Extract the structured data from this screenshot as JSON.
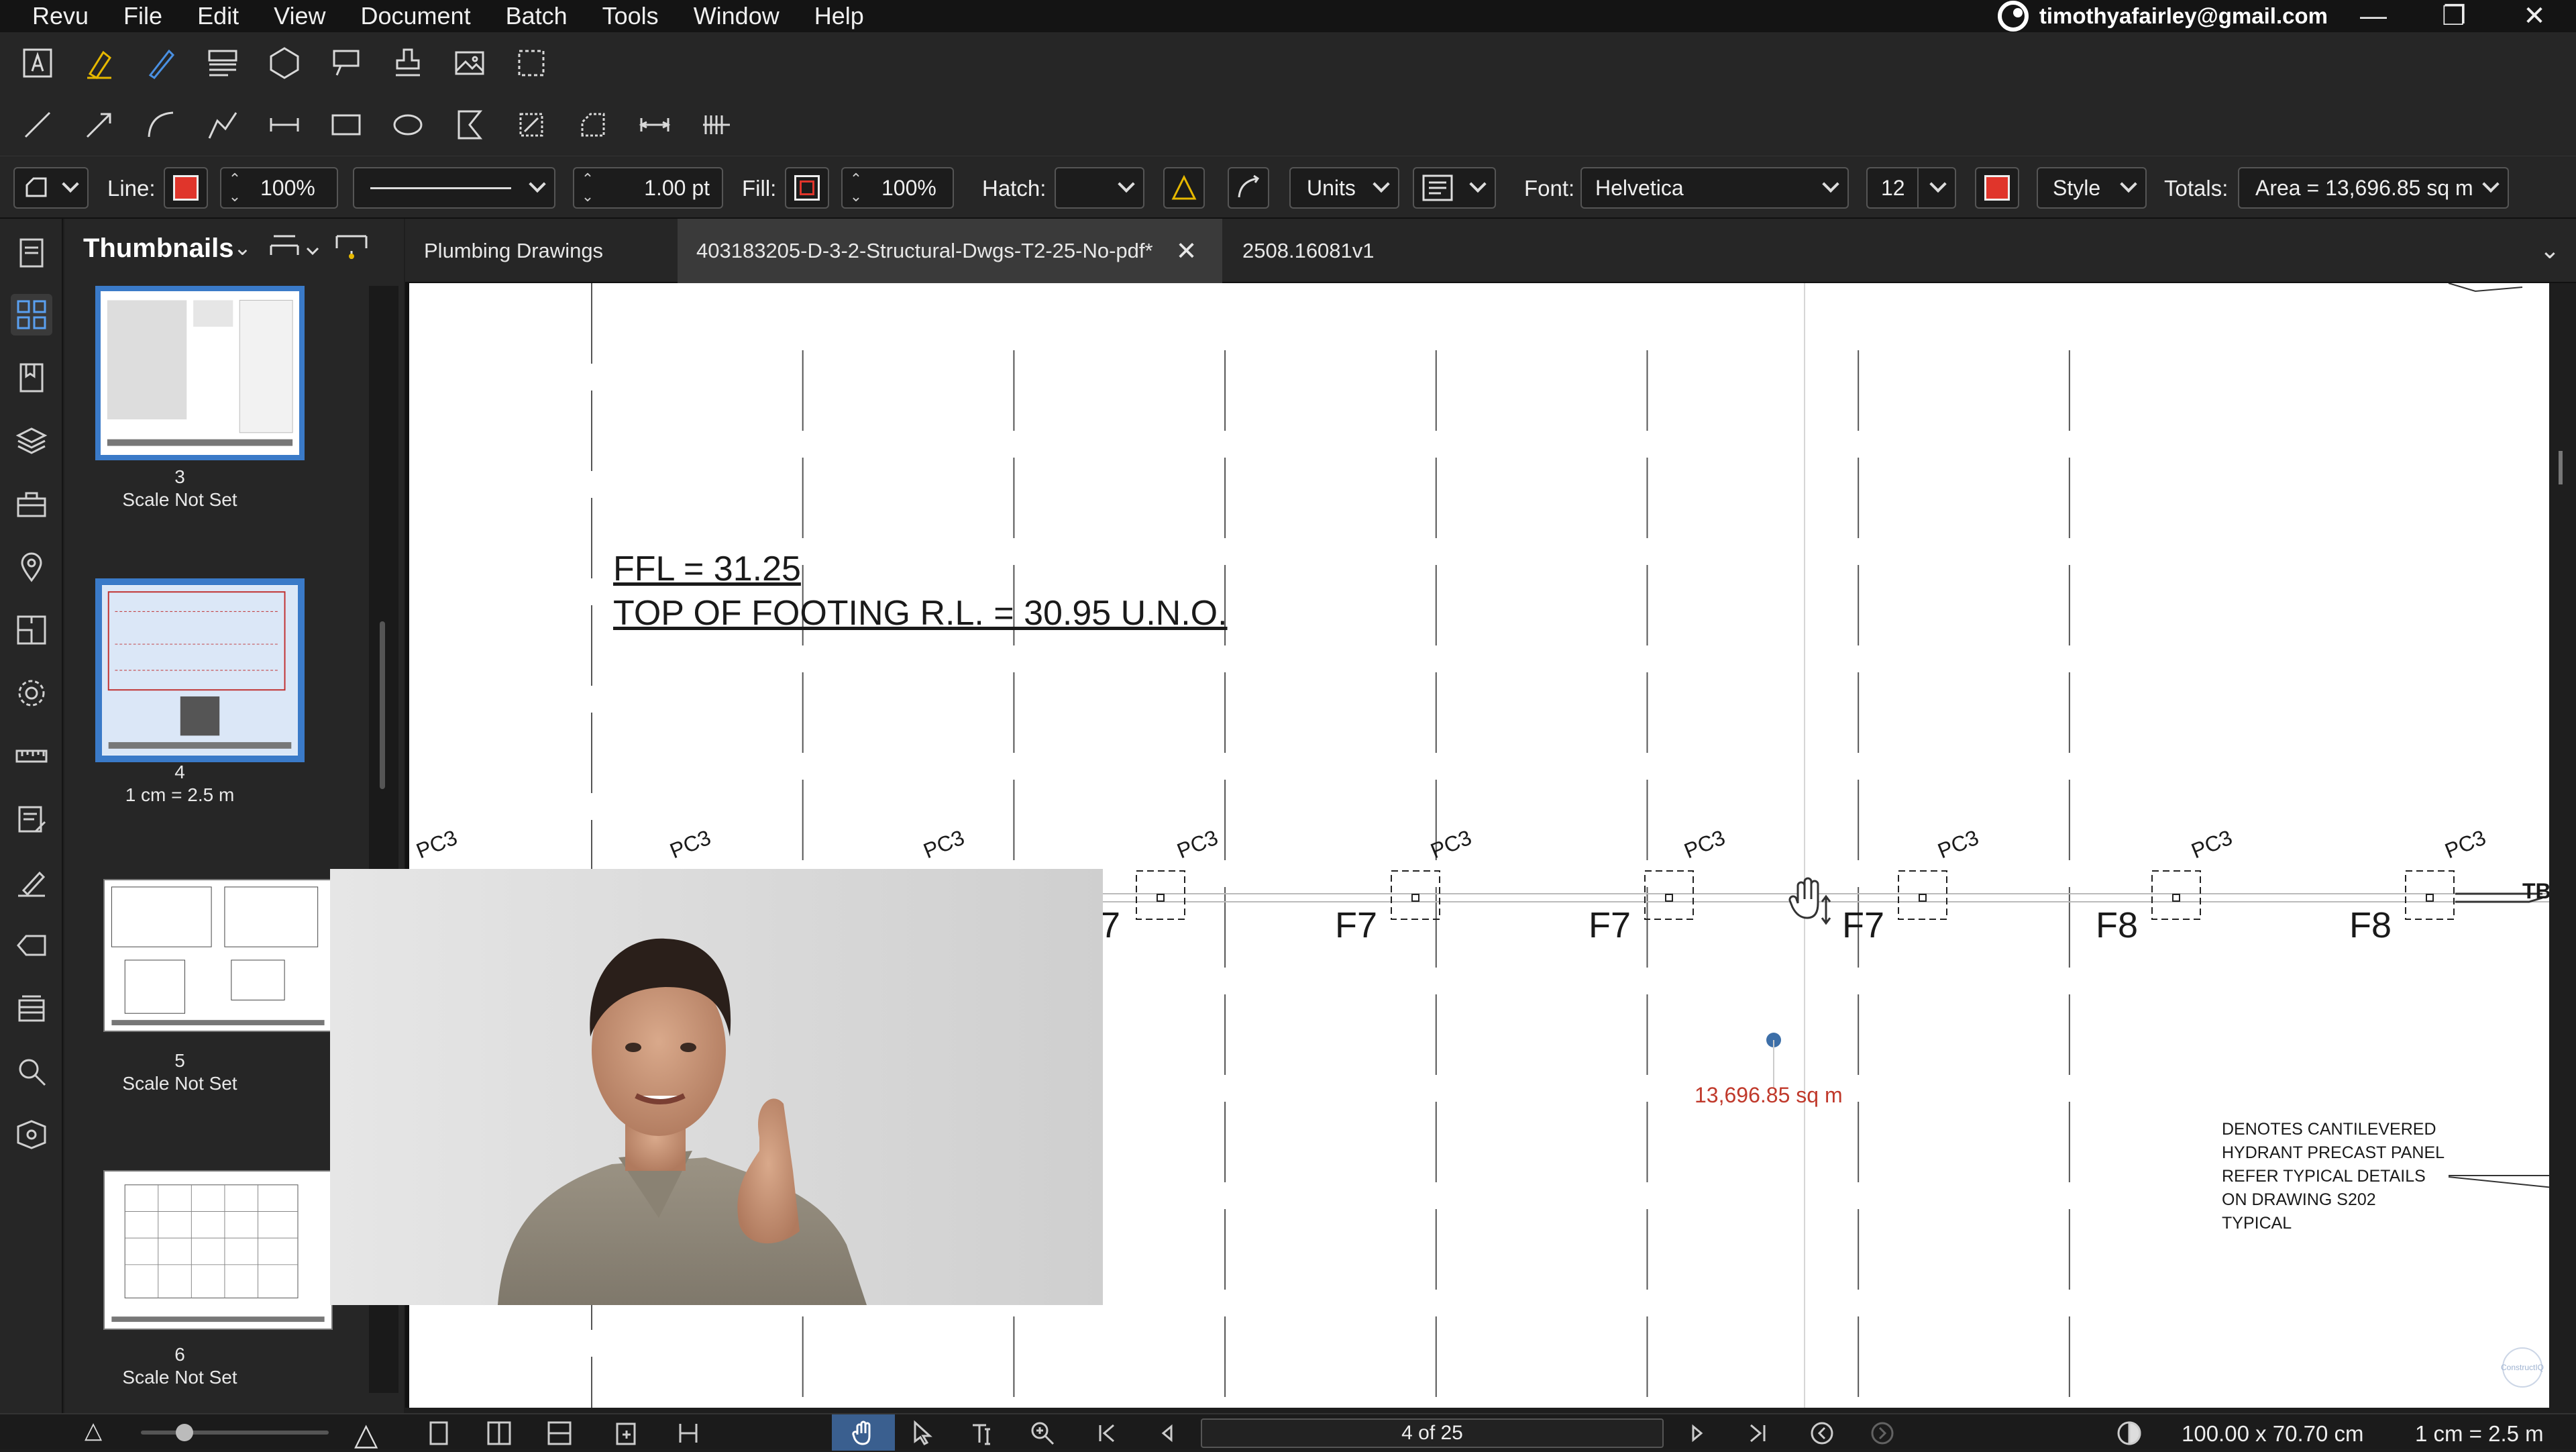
{
  "menu": [
    "Revu",
    "File",
    "Edit",
    "View",
    "Document",
    "Batch",
    "Tools",
    "Window",
    "Help"
  ],
  "account": {
    "email": "timothyafairley@gmail.com"
  },
  "window_buttons": {
    "minimize": "—",
    "restore": "❐",
    "close": "✕"
  },
  "properties": {
    "line_label": "Line:",
    "line_opacity": "100%",
    "line_width": "1.00 pt",
    "fill_label": "Fill:",
    "fill_opacity": "100%",
    "hatch_label": "Hatch:",
    "units_label": "Units",
    "font_label": "Font:",
    "font_value": "Helvetica",
    "font_size": "12",
    "style_label": "Style",
    "totals_label": "Totals:",
    "totals_value": "Area = 13,696.85 sq m",
    "accent_color": "#e0352b"
  },
  "thumbnails": {
    "title": "Thumbnails",
    "items": [
      {
        "page": "3",
        "scale": "Scale Not Set"
      },
      {
        "page": "4",
        "scale": "1 cm = 2.5 m"
      },
      {
        "page": "5",
        "scale": "Scale Not Set"
      },
      {
        "page": "6",
        "scale": "Scale Not Set"
      }
    ]
  },
  "tabs": [
    {
      "label": "Plumbing Drawings"
    },
    {
      "label": "403183205-D-3-2-Structural-Dwgs-T2-25-No-pdf*",
      "close": "✕"
    },
    {
      "label": "2508.16081v1"
    }
  ],
  "drawing": {
    "note_line1": "FFL = 31.25",
    "note_line2": "TOP OF FOOTING R.L. = 30.95 U.N.O.",
    "panel_tag": "PC3",
    "footings": [
      "7",
      "F7",
      "F7",
      "F7",
      "F8",
      "F8"
    ],
    "edge_tag": "TB",
    "measurement": "13,696.85 sq m",
    "legend_lines": [
      "DENOTES CANTILEVERED",
      "HYDRANT PRECAST PANEL",
      "REFER TYPICAL DETAILS",
      "ON DRAWING S202",
      "TYPICAL"
    ],
    "watermark": "ConstructIQ",
    "measurement_color": "#c0392b"
  },
  "status": {
    "page": "4 of 25",
    "size": "100.00 x 70.70 cm",
    "scale": "1 cm = 2.5 m"
  }
}
